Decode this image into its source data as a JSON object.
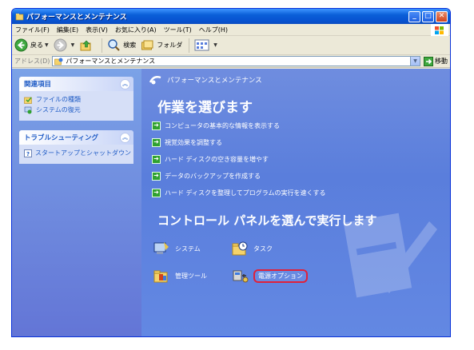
{
  "window": {
    "title": "パフォーマンスとメンテナンス"
  },
  "menu": [
    "ファイル(F)",
    "編集(E)",
    "表示(V)",
    "お気に入り(A)",
    "ツール(T)",
    "ヘルプ(H)"
  ],
  "toolbar": {
    "back": "戻る",
    "search": "検索",
    "folders": "フォルダ"
  },
  "address": {
    "label": "アドレス(D)",
    "value": "パフォーマンスとメンテナンス",
    "go": "移動"
  },
  "sidebar": {
    "related": {
      "title": "関連項目",
      "links": [
        "ファイルの種類",
        "システムの復元"
      ]
    },
    "troubleshoot": {
      "title": "トラブルシューティング",
      "links": [
        "スタートアップとシャットダウン"
      ]
    }
  },
  "main": {
    "category": "パフォーマンスとメンテナンス",
    "task_heading": "作業を選びます",
    "tasks": [
      "コンピュータの基本的な情報を表示する",
      "視覚効果を調整する",
      "ハード ディスクの空き容量を増やす",
      "データのバックアップを作成する",
      "ハード ディスクを整理してプログラムの実行を速くする"
    ],
    "cp_heading": "コントロール パネルを選んで実行します",
    "icons": [
      "システム",
      "タスク",
      "管理ツール",
      "電源オプション"
    ]
  },
  "colors": {
    "title_bar": "#0752d0",
    "sidebar": "#7ba2e7",
    "main": "#6388e3",
    "highlight": "#e0213a"
  }
}
